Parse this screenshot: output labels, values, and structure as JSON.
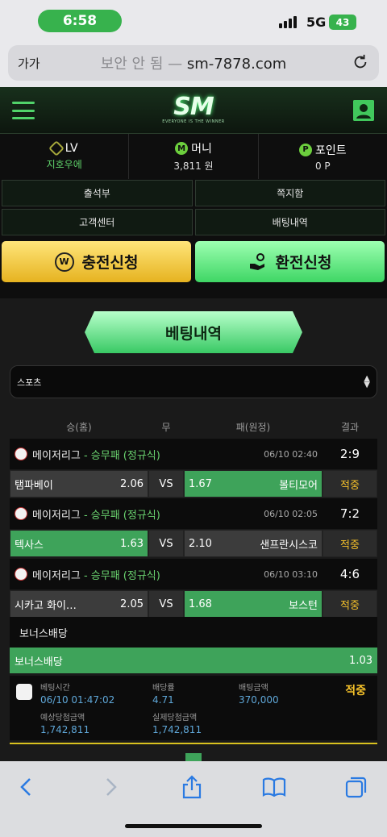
{
  "status_bar": {
    "time": "6:58",
    "network": "5G",
    "battery": "43"
  },
  "browser": {
    "text_size": "가가",
    "security_note": "보안 안 됨",
    "separator": "—",
    "domain": "sm-7878.com"
  },
  "site": {
    "logo": "SM",
    "logo_tagline": "EVERYONE IS THE WINNER",
    "stats": [
      {
        "icon": "level-icon",
        "label": "LV",
        "value": "지호우에"
      },
      {
        "icon": "money-icon",
        "badge": "M",
        "label": "머니",
        "value": "3,811 원"
      },
      {
        "icon": "point-icon",
        "badge": "P",
        "label": "포인트",
        "value": "0 P"
      }
    ],
    "links": [
      "출석부",
      "쪽지함",
      "고객센터",
      "배팅내역"
    ],
    "charge_button": {
      "label": "충전신청",
      "icon_text": "W"
    },
    "exchange_button": {
      "label": "환전신청"
    },
    "section_title": "베팅내역",
    "sport_select": {
      "value": "스포츠"
    },
    "table_headers": {
      "home": "승(홈)",
      "draw": "무",
      "away": "패(원정)",
      "result": "결과"
    },
    "games": [
      {
        "league": "메이저리그",
        "dash": " - ",
        "market": "승무패 (정규식)",
        "date": "06/10 02:40",
        "score": "2:9",
        "home": "탬파베이",
        "home_odds": "2.06",
        "vs": "VS",
        "away_odds": "1.67",
        "away": "볼티모어",
        "result": "적중",
        "winner": "away"
      },
      {
        "league": "메이저리그",
        "dash": " - ",
        "market": "승무패 (정규식)",
        "date": "06/10 02:05",
        "score": "7:2",
        "home": "텍사스",
        "home_odds": "1.63",
        "vs": "VS",
        "away_odds": "2.10",
        "away": "샌프란시스코",
        "result": "적중",
        "winner": "home"
      },
      {
        "league": "메이저리그",
        "dash": " - ",
        "market": "승무패 (정규식)",
        "date": "06/10 03:10",
        "score": "4:6",
        "home": "시카고 화이…",
        "home_odds": "2.05",
        "vs": "VS",
        "away_odds": "1.68",
        "away": "보스턴",
        "result": "적중",
        "winner": "away"
      }
    ],
    "bonus": {
      "label": "보너스배당",
      "row_label": "보너스배당",
      "value": "1.03"
    },
    "summary": {
      "bet_time_label": "베팅시간",
      "bet_time": "06/10 01:47:02",
      "odds_label": "배당률",
      "odds": "4.71",
      "amount_label": "배팅금액",
      "amount": "370,000",
      "expected_label": "예상당첨금액",
      "expected": "1,742,811",
      "actual_label": "실제당첨금액",
      "actual": "1,742,811",
      "status": "적중"
    }
  },
  "colors": {
    "accent_green": "#3ea35a",
    "gold": "#f6c22a",
    "status_green": "#37b24d"
  }
}
